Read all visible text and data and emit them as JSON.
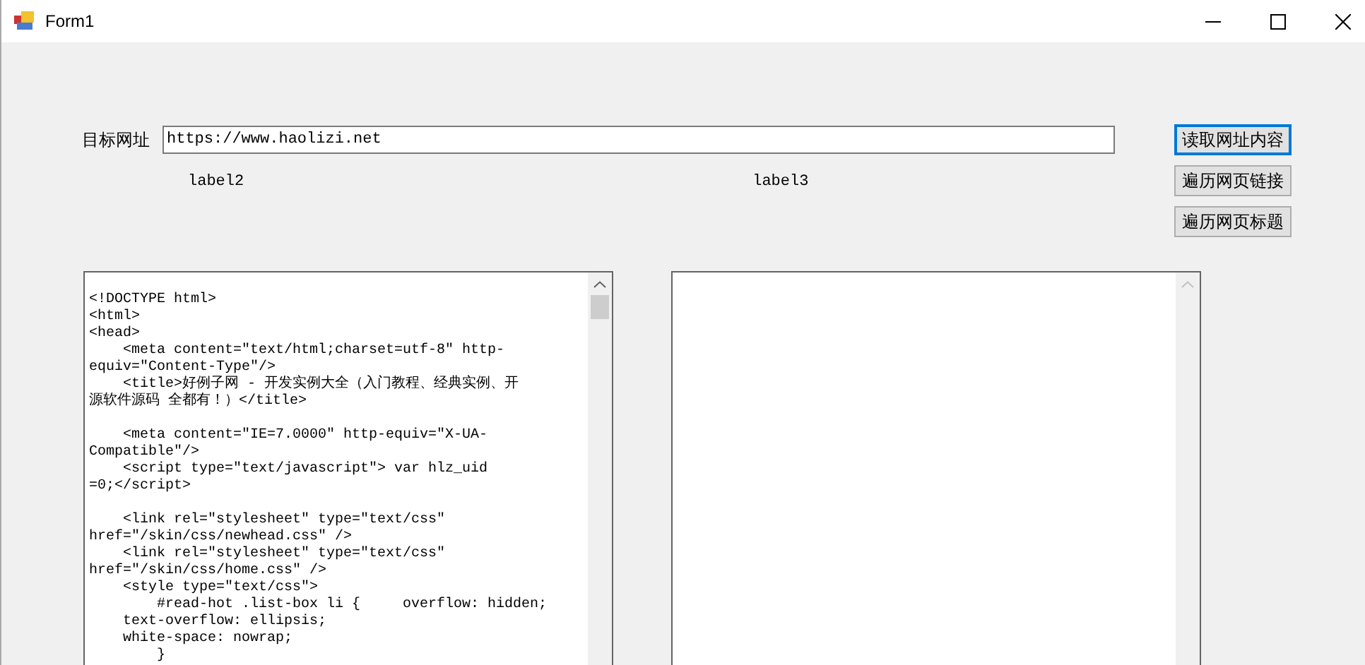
{
  "window": {
    "title": "Form1"
  },
  "url_label": "目标网址",
  "url_field": {
    "value": "https://www.haolizi.net"
  },
  "labels": [
    "label2",
    "label3"
  ],
  "buttons": [
    {
      "label": "读取网址内容",
      "focused": true
    },
    {
      "label": "遍历网页链接",
      "focused": false
    },
    {
      "label": "遍历网页标题",
      "focused": false
    }
  ],
  "source_box": {
    "paragraphs": [
      {
        "lines": [
          "<!DOCTYPE html>",
          "<html>",
          "<head>",
          "    <meta content=\"text/html;charset=utf-8\" http-",
          "equiv=\"Content-Type\"/>",
          "    <title>好例子网 - 开发实例大全（入门教程、经典实例、开",
          "源软件源码 全都有！）</title>"
        ]
      },
      {
        "lines": [
          "    <meta content=\"IE=7.0000\" http-equiv=\"X-UA-",
          "Compatible\"/>",
          "    <script type=\"text/javascript\"> var hlz_uid",
          "=0;</script>"
        ]
      },
      {
        "lines": [
          "    <link rel=\"stylesheet\" type=\"text/css\"",
          "href=\"/skin/css/newhead.css\" />",
          "    <link rel=\"stylesheet\" type=\"text/css\"",
          "href=\"/skin/css/home.css\" />",
          "    <style type=\"text/css\">",
          "        #read-hot .list-box li {     overflow: hidden;",
          "    text-overflow: ellipsis;",
          "    white-space: nowrap;",
          "        }"
        ]
      }
    ]
  }
}
